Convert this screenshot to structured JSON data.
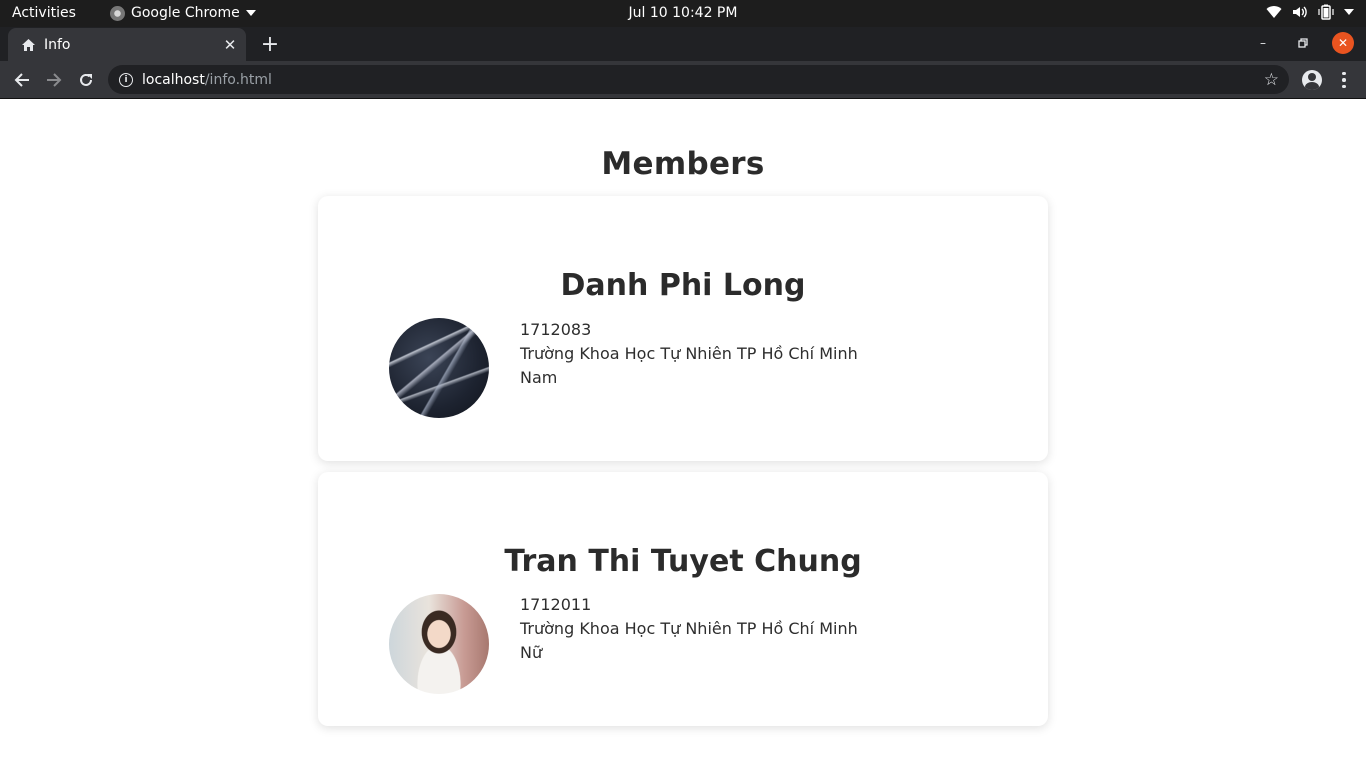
{
  "system_bar": {
    "activities": "Activities",
    "app_name": "Google Chrome",
    "clock": "Jul 10  10:42 PM"
  },
  "browser": {
    "tab_title": "Info",
    "url_host": "localhost",
    "url_path": "/info.html"
  },
  "page": {
    "title": "Members",
    "members": [
      {
        "name": "Danh Phi Long",
        "id": "1712083",
        "school": "Trường Khoa Học Tự Nhiên TP Hồ Chí Minh",
        "gender": "Nam"
      },
      {
        "name": "Tran Thi Tuyet Chung",
        "id": "1712011",
        "school": "Trường Khoa Học Tự Nhiên TP Hồ Chí Minh",
        "gender": "Nữ"
      }
    ]
  },
  "colors": {
    "topbar_bg": "#1d1d1d",
    "chrome_frame": "#202124",
    "chrome_toolbar": "#35363a",
    "close_accent": "#e95420",
    "heading_text": "#2b2b2b"
  },
  "icons": {
    "tab": "home-icon",
    "back": "arrow-left-icon",
    "forward": "arrow-right-icon",
    "reload": "reload-icon",
    "site_info": "info-icon",
    "bookmark": "star-icon",
    "account": "account-icon",
    "menu": "more-vertical-icon"
  }
}
